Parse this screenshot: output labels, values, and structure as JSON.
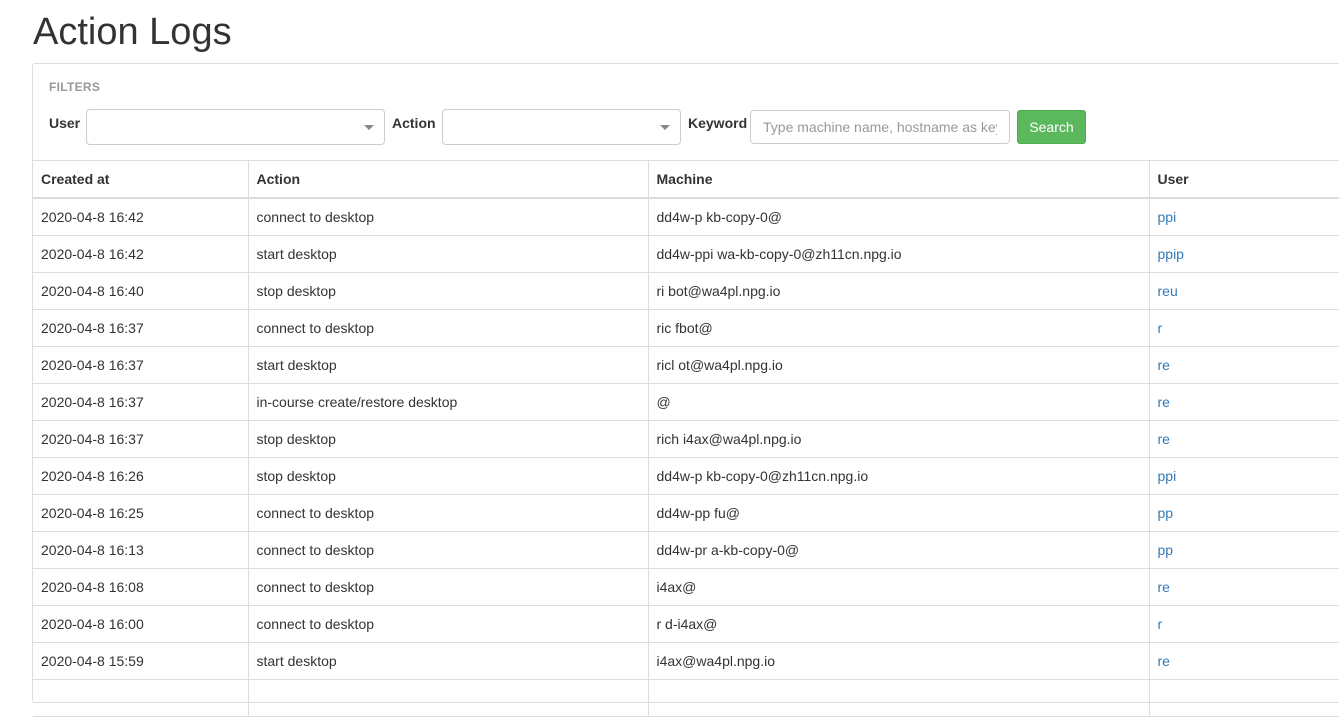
{
  "page": {
    "title": "Action Logs"
  },
  "filters": {
    "heading": "FILTERS",
    "user_label": "User",
    "user_value": "",
    "action_label": "Action",
    "action_value": "",
    "keyword_label": "Keyword",
    "keyword_value": "",
    "keyword_placeholder": "Type machine name, hostname as keyword",
    "search_label": "Search"
  },
  "colors": {
    "search_button": "#5cb85c",
    "link": "#337ab7",
    "border": "#dddddd"
  },
  "table": {
    "columns": [
      "Created at",
      "Action",
      "Machine",
      "User"
    ],
    "rows": [
      {
        "created_at": "2020-04-8 16:42",
        "action": "connect to desktop",
        "machine": "dd4w-p kb-copy-0@",
        "user": "ppi"
      },
      {
        "created_at": "2020-04-8 16:42",
        "action": "start desktop",
        "machine": "dd4w-ppi wa-kb-copy-0@zh11cn.npg.io",
        "user": "ppip"
      },
      {
        "created_at": "2020-04-8 16:40",
        "action": "stop desktop",
        "machine": "ri bot@wa4pl.npg.io",
        "user": "reu"
      },
      {
        "created_at": "2020-04-8 16:37",
        "action": "connect to desktop",
        "machine": "ric fbot@",
        "user": "r"
      },
      {
        "created_at": "2020-04-8 16:37",
        "action": "start desktop",
        "machine": "ricl ot@wa4pl.npg.io",
        "user": "re"
      },
      {
        "created_at": "2020-04-8 16:37",
        "action": "in-course create/restore desktop",
        "machine": "@",
        "user": "re"
      },
      {
        "created_at": "2020-04-8 16:37",
        "action": "stop desktop",
        "machine": "rich i4ax@wa4pl.npg.io",
        "user": "re"
      },
      {
        "created_at": "2020-04-8 16:26",
        "action": "stop desktop",
        "machine": "dd4w-p kb-copy-0@zh11cn.npg.io",
        "user": "ppi"
      },
      {
        "created_at": "2020-04-8 16:25",
        "action": "connect to desktop",
        "machine": "dd4w-pp fu@",
        "user": "pp"
      },
      {
        "created_at": "2020-04-8 16:13",
        "action": "connect to desktop",
        "machine": "dd4w-pr a-kb-copy-0@",
        "user": "pp"
      },
      {
        "created_at": "2020-04-8 16:08",
        "action": "connect to desktop",
        "machine": "i4ax@",
        "user": "re"
      },
      {
        "created_at": "2020-04-8 16:00",
        "action": "connect to desktop",
        "machine": "r d-i4ax@",
        "user": "r"
      },
      {
        "created_at": "2020-04-8 15:59",
        "action": "start desktop",
        "machine": "i4ax@wa4pl.npg.io",
        "user": "re"
      },
      {
        "created_at": "",
        "action": "",
        "machine": "",
        "user": ""
      }
    ]
  }
}
